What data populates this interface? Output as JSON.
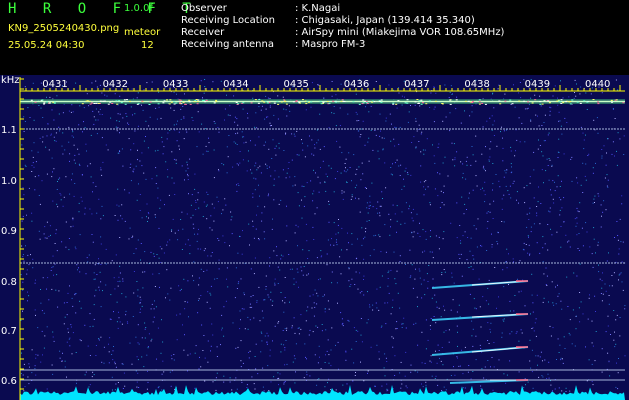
{
  "header": {
    "brand": "H R O F F T",
    "version": "1.0.0f",
    "filename": "KN9_2505240430.png",
    "timestamp": "25.05.24 04:30",
    "meteor_label": "meteor",
    "meteor_count": "12"
  },
  "info": [
    {
      "key": "Observer",
      "value": ": K.Nagai"
    },
    {
      "key": "Receiving Location",
      "value": ": Chigasaki, Japan (139.414 35.340)"
    },
    {
      "key": "Receiver",
      "value": ": AirSpy mini (Miakejima VOR 108.65MHz)"
    },
    {
      "key": "Receiving antenna",
      "value": ": Maspro FM-3"
    }
  ],
  "plot": {
    "y_unit": "kHz",
    "time_labels": [
      "0431",
      "0432",
      "0433",
      "0434",
      "0435",
      "0436",
      "0437",
      "0438",
      "0439",
      "0440"
    ],
    "y_ticks": [
      "1.1",
      "1.0",
      "0.9",
      "0.8",
      "0.7",
      "0.6"
    ],
    "colors": {
      "background": "#0a0a50",
      "frame": "#ffff00",
      "noise_floor": "#00e5ff",
      "carrier": "#c8ffc8",
      "hline": "#cfe0ff"
    }
  }
}
